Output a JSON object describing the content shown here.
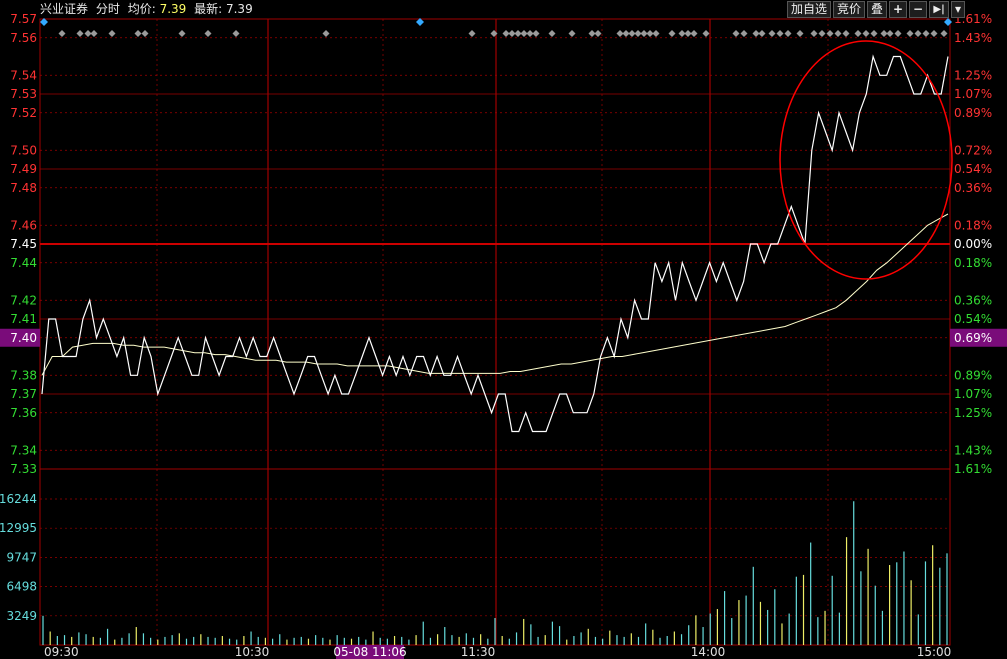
{
  "header": {
    "stock_name": "兴业证券",
    "mode": "分时",
    "avg_label": "均价:",
    "avg_value": "7.39",
    "last_label": "最新:",
    "last_value": "7.39"
  },
  "toolbar": {
    "add_watch": "加自选",
    "auction": "竞价",
    "overlay": "叠",
    "zoom_in": "+",
    "zoom_out": "−",
    "expand": "▶|",
    "menu": "▾"
  },
  "colors": {
    "grid_red": "#a00000",
    "baseline_red": "#cc0000",
    "price_line": "#ffffff",
    "avg_line": "#ffffcc",
    "up_text": "#ff3333",
    "down_text": "#33dd33",
    "volume_cyan": "#66dddd",
    "volume_yellow": "#eeee66",
    "highlight_label_bg": "#7a0c7a",
    "annotation_circle": "#ff0000",
    "event_marker_gray": "#9a9a9a",
    "event_marker_blue": "#33aaff"
  },
  "chart_data": {
    "type": "line",
    "prev_close": 7.45,
    "price_axis_labels": [
      "7.57",
      "7.56",
      "7.54",
      "7.53",
      "7.52",
      "7.50",
      "7.49",
      "7.48",
      "7.46",
      "7.45",
      "7.44",
      "7.42",
      "7.41",
      "7.40",
      "7.38",
      "7.37",
      "7.36",
      "7.34",
      "7.33"
    ],
    "pct_axis_labels": [
      "1.61%",
      "1.43%",
      "1.25%",
      "1.07%",
      "0.89%",
      "0.72%",
      "0.54%",
      "0.36%",
      "0.18%",
      "0.00%",
      "0.18%",
      "0.36%",
      "0.54%",
      "0.69%",
      "0.89%",
      "1.07%",
      "1.25%",
      "1.43%",
      "1.61%"
    ],
    "highlight_price": "7.40",
    "highlight_pct": "0.69%",
    "volume_axis_labels": [
      "16244",
      "12995",
      "9747",
      "6498",
      "3249"
    ],
    "volume_max": 16244,
    "time_labels": [
      "09:30",
      "10:30",
      "11:30",
      "14:00",
      "15:00"
    ],
    "crosshair_time_label": "05-08 11:06",
    "series": [
      {
        "values": [
          7.37,
          7.41,
          7.41,
          7.39,
          7.39,
          7.39,
          7.41,
          7.42,
          7.4,
          7.41,
          7.4,
          7.39,
          7.4,
          7.38,
          7.38,
          7.4,
          7.39,
          7.37,
          7.38,
          7.39,
          7.4,
          7.39,
          7.38,
          7.38,
          7.4,
          7.39,
          7.38,
          7.39,
          7.39,
          7.4,
          7.39,
          7.4,
          7.39,
          7.39,
          7.4,
          7.39,
          7.38,
          7.37,
          7.38,
          7.39,
          7.39,
          7.38,
          7.37,
          7.38,
          7.37,
          7.37,
          7.38,
          7.39,
          7.4,
          7.39,
          7.38,
          7.39,
          7.38,
          7.39,
          7.38,
          7.39,
          7.39,
          7.38,
          7.39,
          7.38,
          7.38,
          7.39,
          7.38,
          7.37,
          7.38,
          7.37,
          7.36,
          7.37,
          7.37,
          7.35,
          7.35,
          7.36,
          7.35,
          7.35,
          7.35,
          7.36,
          7.37,
          7.37,
          7.36,
          7.36,
          7.36,
          7.37,
          7.39,
          7.4,
          7.39,
          7.41,
          7.4,
          7.42,
          7.41,
          7.41,
          7.44,
          7.43,
          7.44,
          7.42,
          7.44,
          7.43,
          7.42,
          7.43,
          7.44,
          7.43,
          7.44,
          7.43,
          7.42,
          7.43,
          7.45,
          7.45,
          7.44,
          7.45,
          7.45,
          7.46,
          7.47,
          7.46,
          7.45,
          7.5,
          7.52,
          7.51,
          7.5,
          7.52,
          7.51,
          7.5,
          7.52,
          7.53,
          7.55,
          7.54,
          7.54,
          7.55,
          7.55,
          7.54,
          7.53,
          7.53,
          7.54,
          7.53,
          7.53,
          7.55
        ]
      },
      {
        "values": [
          7.38,
          7.39,
          7.39,
          7.395,
          7.396,
          7.397,
          7.397,
          7.397,
          7.396,
          7.396,
          7.395,
          7.395,
          7.395,
          7.394,
          7.393,
          7.392,
          7.392,
          7.391,
          7.391,
          7.39,
          7.389,
          7.388,
          7.388,
          7.388,
          7.387,
          7.387,
          7.387,
          7.386,
          7.386,
          7.386,
          7.385,
          7.385,
          7.385,
          7.385,
          7.385,
          7.384,
          7.383,
          7.382,
          7.381,
          7.381,
          7.381,
          7.381,
          7.381,
          7.381,
          7.381,
          7.381,
          7.382,
          7.382,
          7.383,
          7.384,
          7.385,
          7.386,
          7.386,
          7.387,
          7.388,
          7.389,
          7.39,
          7.39,
          7.391,
          7.392,
          7.393,
          7.394,
          7.395,
          7.396,
          7.397,
          7.398,
          7.399,
          7.4,
          7.401,
          7.402,
          7.403,
          7.404,
          7.405,
          7.406,
          7.408,
          7.41,
          7.412,
          7.414,
          7.416,
          7.42,
          7.425,
          7.43,
          7.436,
          7.44,
          7.445,
          7.45,
          7.455,
          7.46,
          7.463,
          7.466
        ]
      }
    ],
    "volume": [
      3249,
      1500,
      1000,
      1100,
      900,
      1400,
      1200,
      900,
      800,
      1800,
      600,
      800,
      1300,
      2000,
      1300,
      800,
      600,
      900,
      1100,
      1300,
      700,
      900,
      1200,
      900,
      800,
      1000,
      700,
      600,
      1000,
      1500,
      900,
      800,
      700,
      1200,
      600,
      800,
      900,
      700,
      1100,
      800,
      600,
      1100,
      800,
      700,
      900,
      600,
      1500,
      800,
      700,
      1000,
      900,
      600,
      1100,
      2600,
      800,
      1200,
      2000,
      1100,
      900,
      1300,
      800,
      1200,
      700,
      3000,
      1000,
      700,
      1400,
      2900,
      2300,
      900,
      1100,
      2600,
      2100,
      600,
      1000,
      1400,
      1800,
      900,
      700,
      1600,
      1100,
      900,
      1300,
      900,
      2400,
      1700,
      800,
      1000,
      1500,
      1200,
      2200,
      3300,
      2000,
      3500,
      4000,
      6000,
      3000,
      5000,
      5500,
      8700,
      4800,
      3900,
      6200,
      2400,
      3500,
      7600,
      7800,
      11400,
      3100,
      3800,
      7700,
      3600,
      12000,
      16000,
      8200,
      10700,
      6600,
      3800,
      8900,
      9200,
      10400,
      7200,
      3400,
      9300,
      11100,
      8600,
      10200
    ]
  },
  "event_markers": [
    "gray",
    "blue"
  ]
}
